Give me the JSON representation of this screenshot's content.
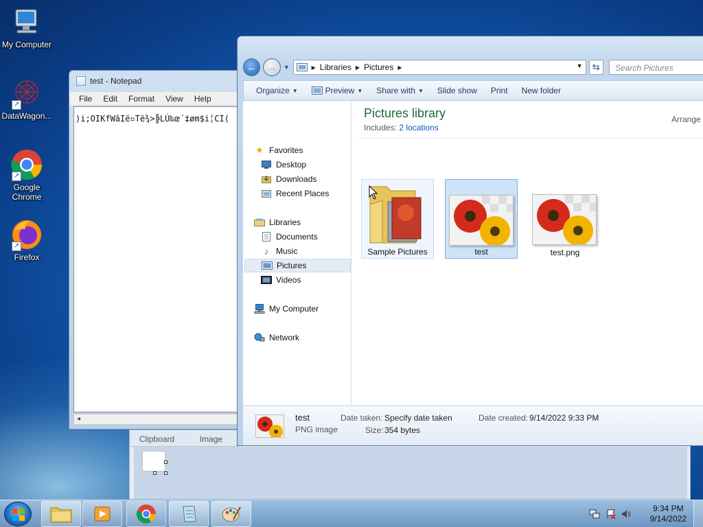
{
  "desktop": {
    "icons": [
      {
        "label": "My Computer",
        "icon": "computer-icon"
      },
      {
        "label": "DataWagon...",
        "icon": "datawagon-icon"
      },
      {
        "label": "Google Chrome",
        "icon": "chrome-icon"
      },
      {
        "label": "Firefox",
        "icon": "firefox-icon"
      }
    ]
  },
  "notepad": {
    "title": "test - Notepad",
    "menu": [
      "File",
      "Edit",
      "Format",
      "View",
      "Help"
    ],
    "content": ")i;OIKfWãIë▫Të¾>╠LÚ‰œ´‡øm$i╎CI(",
    "scroll_arrow": "◂"
  },
  "paint": {
    "tabs": [
      "Clipboard",
      "Image"
    ]
  },
  "explorer": {
    "breadcrumb": [
      "Libraries",
      "Pictures"
    ],
    "search_placeholder": "Search Pictures",
    "commands": [
      {
        "label": "Organize",
        "dropdown": true
      },
      {
        "label": "Preview",
        "dropdown": true
      },
      {
        "label": "Share with",
        "dropdown": true
      },
      {
        "label": "Slide show",
        "dropdown": false
      },
      {
        "label": "Print",
        "dropdown": false
      },
      {
        "label": "New folder",
        "dropdown": false
      }
    ],
    "nav": {
      "favorites": {
        "label": "Favorites",
        "items": [
          "Desktop",
          "Downloads",
          "Recent Places"
        ]
      },
      "libraries": {
        "label": "Libraries",
        "items": [
          "Documents",
          "Music",
          "Pictures",
          "Videos"
        ]
      },
      "computer": "My Computer",
      "network": "Network",
      "selected": "Pictures"
    },
    "library": {
      "title": "Pictures library",
      "includes_label": "Includes:",
      "includes_link": "2 locations",
      "arrange": "Arrange"
    },
    "items": [
      {
        "label": "Sample Pictures",
        "type": "folder"
      },
      {
        "label": "test",
        "type": "image",
        "selected": true
      },
      {
        "label": "test.png",
        "type": "image"
      }
    ],
    "details": {
      "name": "test",
      "type": "PNG image",
      "date_taken_label": "Date taken:",
      "date_taken": "Specify date taken",
      "size_label": "Size:",
      "size": "354 bytes",
      "date_created_label": "Date created:",
      "date_created": "9/14/2022 9:33 PM"
    }
  },
  "taskbar": {
    "buttons": [
      "explorer-icon",
      "media-player-icon",
      "chrome-icon",
      "notepad-icon",
      "paint-icon"
    ],
    "time": "9:34 PM",
    "date": "9/14/2022"
  }
}
